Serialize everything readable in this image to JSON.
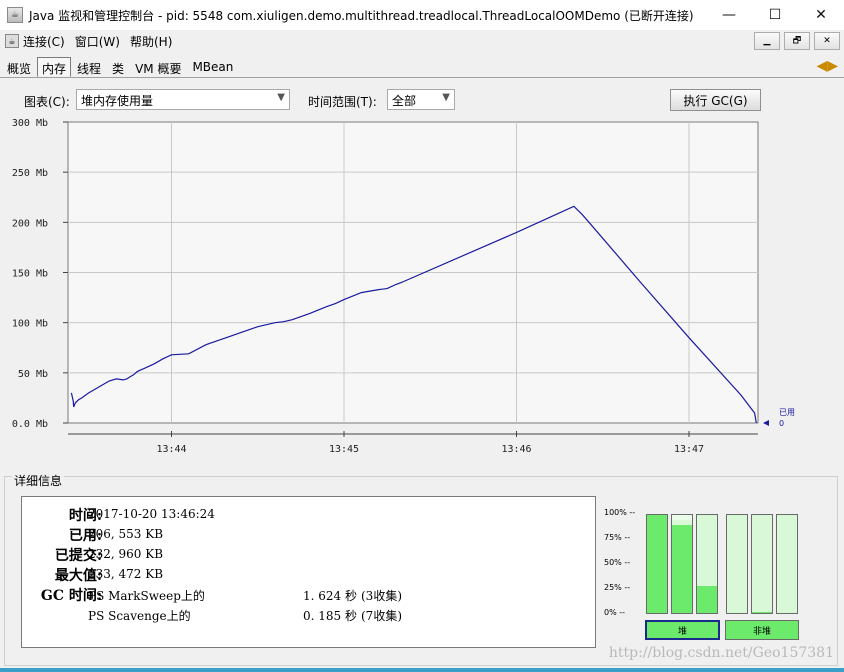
{
  "window": {
    "title": "Java 监视和管理控制台 - pid: 5548 com.xiuligen.demo.multithread.treadlocal.ThreadLocalOOMDemo (已断开连接)",
    "minimize": "—",
    "maximize": "☐",
    "close": "✕"
  },
  "menu": {
    "items": [
      "连接(C)",
      "窗口(W)",
      "帮助(H)"
    ],
    "mdi_buttons": [
      "▁",
      "🗗",
      "✕"
    ]
  },
  "tabs": [
    "概览",
    "内存",
    "线程",
    "类",
    "VM 概要",
    "MBean"
  ],
  "active_tab": "内存",
  "controls": {
    "chart_label": "图表(C):",
    "chart_value": "堆内存使用量",
    "range_label": "时间范围(T):",
    "range_value": "全部",
    "gc_button": "执行 GC(G)"
  },
  "chart_data": {
    "type": "line",
    "y_ticks": [
      "300 Mb",
      "250 Mb",
      "200 Mb",
      "150 Mb",
      "100 Mb",
      "50 Mb",
      "0.0 Mb"
    ],
    "ylim": [
      0,
      300
    ],
    "x_ticks": [
      "13:44",
      "13:45",
      "13:46",
      "13:47"
    ],
    "legend_label": "已用",
    "legend_value": "0",
    "grid": true,
    "series": [
      {
        "line_color": "#1a1aa0",
        "x": [
          13.42,
          13.43,
          13.433,
          13.44,
          13.442,
          13.46,
          13.48,
          13.52,
          13.55,
          13.56,
          13.6,
          13.64,
          13.68,
          13.72,
          13.74,
          13.78,
          13.8,
          13.81,
          13.85,
          13.9,
          13.95,
          14.0,
          14.1,
          14.2,
          14.25,
          14.35,
          14.45,
          14.5,
          14.6,
          14.65,
          14.7,
          14.8,
          14.9,
          14.95,
          15.0,
          15.1,
          15.2,
          15.25,
          15.3,
          15.333,
          16.0,
          16.333,
          16.38,
          16.42,
          16.72,
          17.0,
          17.3,
          17.38,
          17.39
        ],
        "y": [
          30,
          22,
          16,
          19,
          20,
          23,
          25,
          30,
          33,
          34,
          38,
          42,
          44,
          43,
          44,
          48,
          51,
          52,
          55,
          59,
          64,
          68,
          69,
          78,
          81,
          87,
          93,
          96,
          100,
          101,
          103,
          109,
          116,
          119,
          123,
          130,
          133,
          134,
          138,
          140,
          190,
          216,
          208,
          200,
          140,
          85,
          28,
          10,
          0
        ]
      }
    ]
  },
  "details": {
    "title": "详细信息",
    "rows": [
      {
        "key": "时间:",
        "value": "2017-10-20 13:46:24"
      },
      {
        "key": "已用:",
        "value": "206, 553 KB"
      },
      {
        "key": "已提交:",
        "value": "232, 960 KB"
      },
      {
        "key": "最大值:",
        "value": "233, 472 KB"
      }
    ],
    "gc_key": "GC 时间:",
    "gc": [
      {
        "name": "PS MarkSweep上的",
        "time": "1. 624 秒",
        "count": "(3收集)"
      },
      {
        "name": "PS Scavenge上的",
        "time": "0. 185 秒",
        "count": "(7收集)"
      }
    ]
  },
  "pools": {
    "pct_labels": [
      "100% --",
      "75% --",
      "50% --",
      "25% --",
      "0% --"
    ],
    "heap_label": "堆",
    "nonheap_label": "非堆",
    "heap_bars": [
      {
        "used": 1.0,
        "committed": 1.0
      },
      {
        "used": 0.9,
        "committed": 0.95
      },
      {
        "used": 0.28,
        "committed": 1.0
      }
    ],
    "nonheap_bars": [
      {
        "used": 0.0,
        "committed": 1.0
      },
      {
        "used": 0.01,
        "committed": 1.0
      },
      {
        "used": 0.0,
        "committed": 1.0
      }
    ]
  },
  "watermark": "http://blog.csdn.net/Geo157381"
}
